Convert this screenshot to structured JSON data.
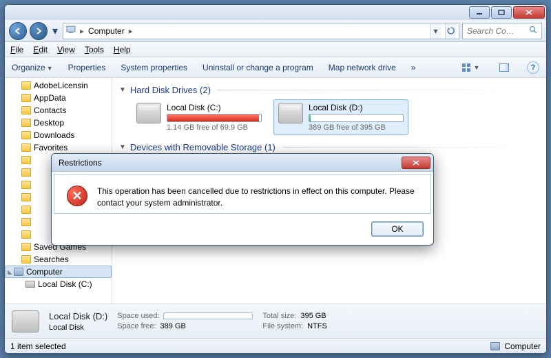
{
  "window": {
    "address_segments": [
      "Computer"
    ],
    "search_placeholder": "Search Co…"
  },
  "menubar": [
    "File",
    "Edit",
    "View",
    "Tools",
    "Help"
  ],
  "toolbar": {
    "organize": "Organize",
    "properties": "Properties",
    "system_properties": "System properties",
    "uninstall": "Uninstall or change a program",
    "map_drive": "Map network drive",
    "more": "»"
  },
  "tree": {
    "items": [
      {
        "label": "AdobeLicensin",
        "icon": "folder"
      },
      {
        "label": "AppData",
        "icon": "folder"
      },
      {
        "label": "Contacts",
        "icon": "folder"
      },
      {
        "label": "Desktop",
        "icon": "folder"
      },
      {
        "label": "Downloads",
        "icon": "folder"
      },
      {
        "label": "Favorites",
        "icon": "folder"
      },
      {
        "label": "",
        "icon": "folder"
      },
      {
        "label": "",
        "icon": "folder"
      },
      {
        "label": "",
        "icon": "folder"
      },
      {
        "label": "",
        "icon": "folder"
      },
      {
        "label": "",
        "icon": "folder"
      },
      {
        "label": "",
        "icon": "folder"
      },
      {
        "label": "",
        "icon": "folder"
      },
      {
        "label": "Saved Games",
        "icon": "folder"
      },
      {
        "label": "Searches",
        "icon": "folder"
      }
    ],
    "computer": "Computer",
    "sub": "Local Disk (C:)"
  },
  "groups": {
    "hdd": {
      "title": "Hard Disk Drives (2)"
    },
    "removable": {
      "title": "Devices with Removable Storage (1)"
    }
  },
  "drives": [
    {
      "label": "Local Disk (C:)",
      "free": "1.14 GB free of 69.9 GB",
      "fill": "red",
      "selected": false
    },
    {
      "label": "Local Disk (D:)",
      "free": "389 GB free of 395 GB",
      "fill": "green",
      "selected": true
    }
  ],
  "details": {
    "title": "Local Disk (D:)",
    "subtitle": "Local Disk",
    "space_used_label": "Space used:",
    "space_free_label": "Space free:",
    "space_free": "389 GB",
    "total_label": "Total size:",
    "total": "395 GB",
    "fs_label": "File system:",
    "fs": "NTFS"
  },
  "statusbar": {
    "left": "1 item selected",
    "right": "Computer"
  },
  "dialog": {
    "title": "Restrictions",
    "message": "This operation has been cancelled due to restrictions in effect on this computer. Please contact your system administrator.",
    "ok": "OK"
  }
}
